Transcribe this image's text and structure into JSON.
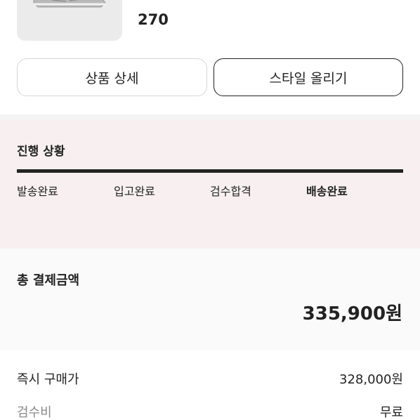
{
  "product": {
    "size": "270",
    "thumbnail_icon": "sneaker-image"
  },
  "actions": {
    "detail_label": "상품 상세",
    "style_label": "스타일 올리기"
  },
  "progress": {
    "title": "진행 상황",
    "steps": [
      "발송완료",
      "입고완료",
      "검수합격",
      "배송완료"
    ],
    "current_step": "배송완료"
  },
  "payment": {
    "total_label": "총 결제금액",
    "total_amount": "335,900원",
    "rows": [
      {
        "label": "즉시 구매가",
        "value": "328,000원"
      },
      {
        "label": "검수비",
        "value": "무료"
      }
    ]
  },
  "colors": {
    "progress_bg": "#f8f0f0",
    "total_bg": "#fafafa",
    "text": "#222222",
    "muted": "#888888"
  }
}
